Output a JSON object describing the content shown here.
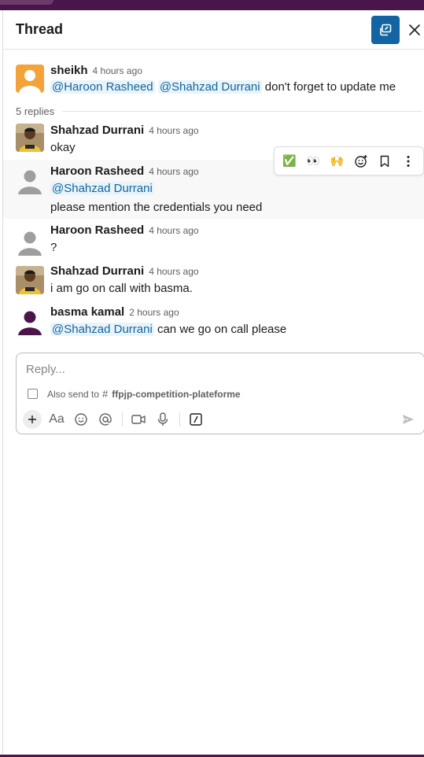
{
  "header": {
    "title": "Thread"
  },
  "parent_message": {
    "author": "sheikh",
    "time": "4 hours ago",
    "mentions": [
      "@Haroon Rasheed",
      "@Shahzad Durrani"
    ],
    "text": "don't forget to update me"
  },
  "replies_label": "5 replies",
  "replies": [
    {
      "author": "Shahzad Durrani",
      "time": "4 hours ago",
      "text": "okay"
    },
    {
      "author": "Haroon Rasheed",
      "time": "4 hours ago",
      "mention": "@Shahzad Durrani",
      "text": "please mention the credentials you need"
    },
    {
      "author": "Haroon Rasheed",
      "time": "4 hours ago",
      "text": "?"
    },
    {
      "author": "Shahzad Durrani",
      "time": "4 hours ago",
      "text": "i am go on call with basma."
    },
    {
      "author": "basma kamal",
      "time": "2 hours ago",
      "mention": "@Shahzad Durrani",
      "text": "can we go on call please"
    }
  ],
  "message_toolbar": {
    "reactions": [
      "✅",
      "👀",
      "🙌"
    ],
    "icons": [
      "add-reaction-icon",
      "bookmark-icon",
      "more-actions-icon"
    ]
  },
  "composer": {
    "placeholder": "Reply...",
    "also_send_label": "Also send to",
    "channel": "ffpjp-competition-plateforme"
  },
  "colors": {
    "accent": "#1264a3",
    "mention_bg": "#e8f4fa",
    "workspace": "#4a154b",
    "avatar_orange": "#f4a33a",
    "avatar_gray": "#9e9e9e",
    "avatar_purple": "#4a154b"
  }
}
